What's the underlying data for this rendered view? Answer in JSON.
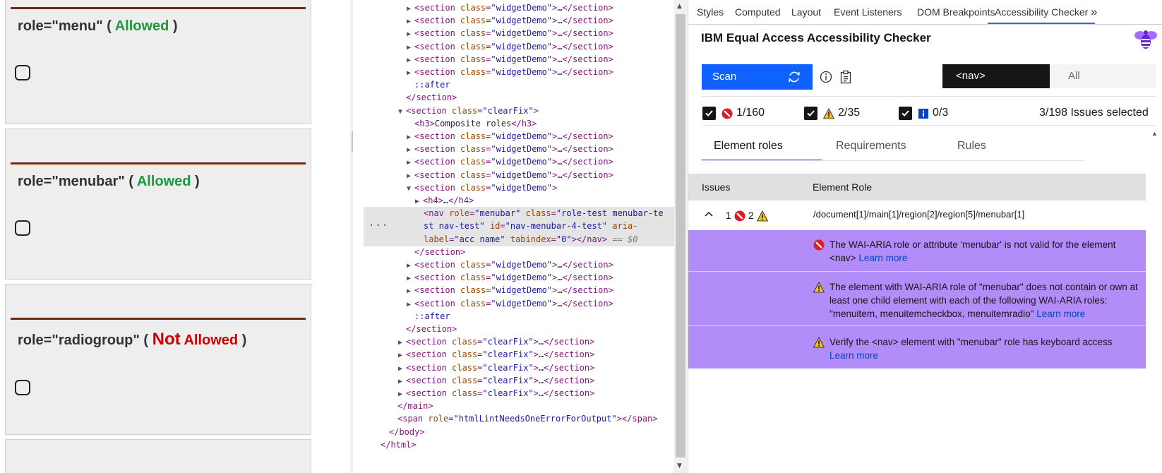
{
  "page_cards": [
    {
      "role": "role=\"menu\"",
      "open": " ( ",
      "status_not": "",
      "status": "Allowed",
      "close": " )",
      "allowed": true
    },
    {
      "role": "role=\"menubar\"",
      "open": " ( ",
      "status_not": "",
      "status": "Allowed",
      "close": " )",
      "allowed": true
    },
    {
      "role": "role=\"radiogroup\"",
      "open": " ( ",
      "status_not": "Not",
      "status": " Allowed",
      "close": " )",
      "allowed": false
    }
  ],
  "elements": {
    "lines": [
      {
        "indent": 3,
        "tri": "▶",
        "tag": "section",
        "cls": "widgetDemo",
        "collapsed": true
      },
      {
        "indent": 3,
        "tri": "▶",
        "tag": "section",
        "cls": "widgetDemo",
        "collapsed": true
      },
      {
        "indent": 3,
        "tri": "▶",
        "tag": "section",
        "cls": "widgetDemo",
        "collapsed": true
      },
      {
        "indent": 3,
        "tri": "▶",
        "tag": "section",
        "cls": "widgetDemo",
        "collapsed": true
      },
      {
        "indent": 3,
        "tri": "▶",
        "tag": "section",
        "cls": "widgetDemo",
        "collapsed": true
      },
      {
        "indent": 3,
        "tri": "▶",
        "tag": "section",
        "cls": "widgetDemo",
        "collapsed": true
      },
      {
        "indent": 3,
        "pseudo": "::after"
      },
      {
        "indent": 2,
        "close": "section"
      },
      {
        "indent": 2,
        "tri": "▼",
        "tag": "section",
        "cls": "clearFix",
        "open": true
      },
      {
        "indent": 3,
        "text_el": "h3",
        "text": "Composite roles"
      },
      {
        "indent": 3,
        "tri": "▶",
        "tag": "section",
        "cls": "widgetDemo",
        "collapsed": true
      },
      {
        "indent": 3,
        "tri": "▶",
        "tag": "section",
        "cls": "widgetDemo",
        "collapsed": true
      },
      {
        "indent": 3,
        "tri": "▶",
        "tag": "section",
        "cls": "widgetDemo",
        "collapsed": true
      },
      {
        "indent": 3,
        "tri": "▶",
        "tag": "section",
        "cls": "widgetDemo",
        "collapsed": true
      },
      {
        "indent": 3,
        "tri": "▼",
        "tag": "section",
        "cls": "widgetDemo",
        "open": true
      },
      {
        "indent": 4,
        "tri": "▶",
        "h4": true
      }
    ],
    "selected": {
      "l1_tag": "<nav ",
      "l1_a1": "role",
      "l1_v1": "\"menubar\"",
      "l1_a2": "class",
      "l1_v2": "\"role-test menubar-te",
      "l2_v2": "st nav-test\"",
      "l2_a3": "id",
      "l2_v3": "\"nav-menubar-4-test\"",
      "l2_a4": "aria-",
      "l3_a4": "label",
      "l3_v4": "\"acc name\"",
      "l3_a5": "tabindex",
      "l3_v5": "\"0\"",
      "l3_close": "</nav>",
      "l3_eq": "== $0"
    },
    "lines_after": [
      {
        "indent": 3,
        "close": "section"
      },
      {
        "indent": 3,
        "tri": "▶",
        "tag": "section",
        "cls": "widgetDemo",
        "collapsed": true
      },
      {
        "indent": 3,
        "tri": "▶",
        "tag": "section",
        "cls": "widgetDemo",
        "collapsed": true
      },
      {
        "indent": 3,
        "tri": "▶",
        "tag": "section",
        "cls": "widgetDemo",
        "collapsed": true
      },
      {
        "indent": 3,
        "tri": "▶",
        "tag": "section",
        "cls": "widgetDemo",
        "collapsed": true
      },
      {
        "indent": 3,
        "pseudo": "::after"
      },
      {
        "indent": 2,
        "close": "section"
      },
      {
        "indent": 2,
        "tri": "▶",
        "tag": "section",
        "cls": "clearFix",
        "collapsed": true
      },
      {
        "indent": 2,
        "tri": "▶",
        "tag": "section",
        "cls": "clearFix",
        "collapsed": true
      },
      {
        "indent": 2,
        "tri": "▶",
        "tag": "section",
        "cls": "clearFix",
        "collapsed": true
      },
      {
        "indent": 2,
        "tri": "▶",
        "tag": "section",
        "cls": "clearFix",
        "collapsed": true
      },
      {
        "indent": 2,
        "tri": "▶",
        "tag": "section",
        "cls": "clearFix",
        "collapsed": true
      },
      {
        "indent": 1,
        "close": "main"
      },
      {
        "indent": 1,
        "span": true,
        "attr": "role",
        "val": "\"htmlLintNeedsOneErrorForOutput\""
      },
      {
        "indent": 0,
        "close": "body"
      },
      {
        "indent": -1,
        "close": "html"
      }
    ]
  },
  "devtools_tabs": [
    "Styles",
    "Computed",
    "Layout",
    "Event Listeners",
    "DOM Breakpoints",
    "Accessibility Checker",
    "»"
  ],
  "checker": {
    "title": "IBM Equal Access Accessibility Checker",
    "scan_label": "Scan",
    "scope_dropdown": "<nav>",
    "scope_all": "All",
    "filters": {
      "violations": "1/160",
      "needs_review": "2/35",
      "recommendations": "0/3"
    },
    "issues_selected": "3/198 Issues selected",
    "subtabs": [
      "Element roles",
      "Requirements",
      "Rules"
    ],
    "table_headers": {
      "issues": "Issues",
      "element_role": "Element Role"
    },
    "row": {
      "violations": "1",
      "warnings": "2",
      "xpath": "/document[1]/main[1]/region[2]/region[5]/menubar[1]"
    },
    "issues": [
      {
        "type": "violation",
        "text": "The WAI-ARIA role or attribute 'menubar' is not valid for the element <nav>",
        "link": "Learn more"
      },
      {
        "type": "warning",
        "text": "The element with WAI-ARIA role of \"menubar\" does not contain or own at least one child element with each of the following WAI-ARIA roles: \"menuitem, menuitemcheckbox, menuitemradio\"",
        "link": "Learn more"
      },
      {
        "type": "warning",
        "text": "Verify the <nav> element with \"menubar\" role has keyboard access",
        "link": "Learn more"
      }
    ]
  },
  "colors": {
    "scan_blue": "#0f62fe",
    "issue_purple": "#b28cf8",
    "allowed": "#1a9a3a",
    "not_allowed": "#cc0000"
  }
}
